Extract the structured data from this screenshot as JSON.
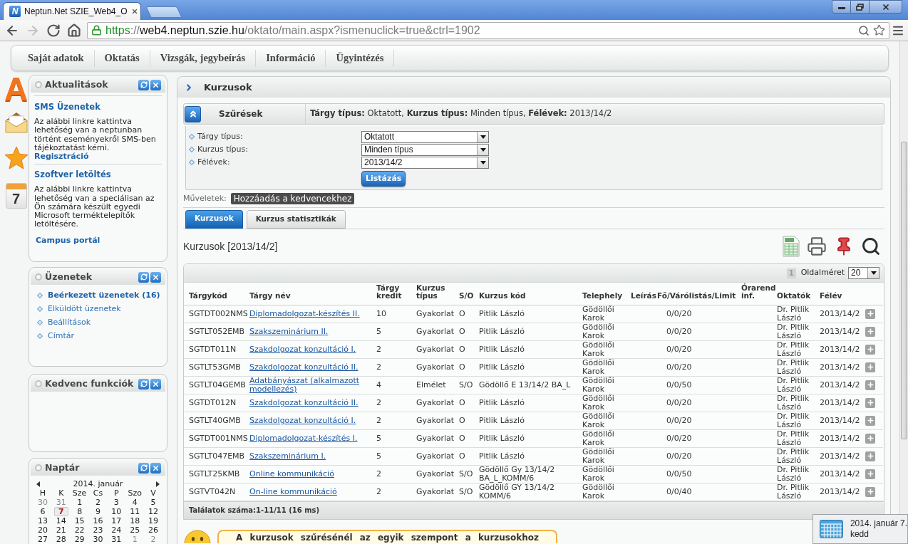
{
  "browser": {
    "tab": {
      "favicon_glyph": "N",
      "title": "Neptun.Net SZIE_Web4_O"
    },
    "nav": [
      {
        "kind": "back",
        "disabled": false
      },
      {
        "kind": "forward",
        "disabled": true
      },
      {
        "kind": "reload",
        "disabled": false
      },
      {
        "kind": "home",
        "disabled": false
      }
    ],
    "url": [
      {
        "kind": "scheme",
        "text": "https"
      },
      {
        "kind": "separator",
        "text": "://"
      },
      {
        "kind": "host",
        "text": "web4.neptun.szie.hu"
      },
      {
        "kind": "path",
        "text": "/oktato/main.aspx?ismenuclick=true&ctrl=1902"
      }
    ]
  },
  "main_menu": [
    "Saját adatok",
    "Oktatás",
    "Vizsgák, jegybeírás",
    "Információ",
    "Ügyintézés"
  ],
  "side_nav": [
    {
      "kind": "letter",
      "glyph": "A"
    },
    {
      "kind": "envelope"
    },
    {
      "kind": "star"
    },
    {
      "kind": "calendar",
      "glyph": "7"
    }
  ],
  "sidebar": [
    {
      "kind": "news",
      "title": "Aktualitások",
      "items": [
        {
          "heading": "SMS Üzenetek",
          "text": "Az alábbi linkre kattintva lehetőség van a neptunban történt eseményekről SMS-ben tájékoztatást kérni.",
          "link": "Regisztráció"
        },
        {
          "heading": "Szoftver letöltés",
          "text": "Az alábbi linkre kattintva lehetőség van a speciálisan az Ön számára készült egyedi Microsoft terméktelepítők letöltésére.",
          "link": "Campus portál"
        }
      ]
    },
    {
      "kind": "links",
      "title": "Üzenetek",
      "items": [
        {
          "label": "Beérkezett üzenetek (16)",
          "unread": true
        },
        {
          "label": "Elküldött üzenetek",
          "unread": false
        },
        {
          "label": "Beállítások",
          "unread": false
        },
        {
          "label": "Címtár",
          "unread": false
        }
      ]
    },
    {
      "kind": "empty",
      "title": "Kedvenc funkciók"
    },
    {
      "kind": "calendar",
      "title": "Naptár",
      "month": "2014. január",
      "weekdays": [
        "H",
        "K",
        "Sze",
        "Cs",
        "P",
        "Szo",
        "V"
      ],
      "weeks": [
        [
          {
            "day": "30",
            "outside": true,
            "today": false
          },
          {
            "day": "31",
            "outside": true,
            "today": false
          },
          {
            "day": "1",
            "outside": false,
            "today": false
          },
          {
            "day": "2",
            "outside": false,
            "today": false
          },
          {
            "day": "3",
            "outside": false,
            "today": false
          },
          {
            "day": "4",
            "outside": false,
            "today": false
          },
          {
            "day": "5",
            "outside": false,
            "today": false
          }
        ],
        [
          {
            "day": "6",
            "outside": false,
            "today": false
          },
          {
            "day": "7",
            "outside": false,
            "today": true
          },
          {
            "day": "8",
            "outside": false,
            "today": false
          },
          {
            "day": "9",
            "outside": false,
            "today": false
          },
          {
            "day": "10",
            "outside": false,
            "today": false
          },
          {
            "day": "11",
            "outside": false,
            "today": false
          },
          {
            "day": "12",
            "outside": false,
            "today": false
          }
        ],
        [
          {
            "day": "13",
            "outside": false,
            "today": false
          },
          {
            "day": "14",
            "outside": false,
            "today": false
          },
          {
            "day": "15",
            "outside": false,
            "today": false
          },
          {
            "day": "16",
            "outside": false,
            "today": false
          },
          {
            "day": "17",
            "outside": false,
            "today": false
          },
          {
            "day": "18",
            "outside": false,
            "today": false
          },
          {
            "day": "19",
            "outside": false,
            "today": false
          }
        ],
        [
          {
            "day": "20",
            "outside": false,
            "today": false
          },
          {
            "day": "21",
            "outside": false,
            "today": false
          },
          {
            "day": "22",
            "outside": false,
            "today": false
          },
          {
            "day": "23",
            "outside": false,
            "today": false
          },
          {
            "day": "24",
            "outside": false,
            "today": false
          },
          {
            "day": "25",
            "outside": false,
            "today": false
          },
          {
            "day": "26",
            "outside": false,
            "today": false
          }
        ],
        [
          {
            "day": "27",
            "outside": false,
            "today": false
          },
          {
            "day": "28",
            "outside": false,
            "today": false
          },
          {
            "day": "29",
            "outside": false,
            "today": false
          },
          {
            "day": "30",
            "outside": false,
            "today": false
          },
          {
            "day": "31",
            "outside": false,
            "today": false
          },
          {
            "day": "1",
            "outside": true,
            "today": false
          },
          {
            "day": "2",
            "outside": true,
            "today": false
          }
        ]
      ]
    }
  ],
  "content": {
    "title": "Kurzusok",
    "filter": {
      "title": "Szűrések",
      "expanded": true,
      "summary": "**Tárgy típus:** Oktatott, **Kurzus típus:** Minden típus, **Félévek:** 2013/14/2",
      "fields": [
        {
          "label": "Tárgy típus:",
          "value": "Oktatott"
        },
        {
          "label": "Kurzus típus:",
          "value": "Minden típus"
        },
        {
          "label": "Félévek:",
          "value": "2013/14/2"
        }
      ],
      "submit": "Listázás"
    },
    "actions": {
      "label": "Műveletek:",
      "buttons": [
        "Hozzáadás a kedvencekhez"
      ]
    },
    "tabs": [
      {
        "label": "Kurzusok",
        "selected": true
      },
      {
        "label": "Kurzus statisztikák",
        "selected": false
      }
    ],
    "list_title": "Kurzusok [2013/14/2]",
    "table": {
      "pages": [
        {
          "label": "1",
          "selected": true
        }
      ],
      "page_size_label": "Oldalméret",
      "page_size": "20",
      "columns": [
        "Tárgykód",
        "Tárgy név",
        "Tárgy kredit",
        "Kurzus típus",
        "S/O",
        "Kurzus kód",
        "Telephely",
        "Leírás",
        "Fő/Várólistás/Limit",
        "Órarend inf.",
        "Oktatók",
        "Félév"
      ],
      "rows": [
        {
          "code": "SGTDT002NMS",
          "name": "Diplomadolgozat-készítés II.",
          "credit": "10",
          "type": "Gyakorlat",
          "so": "O",
          "course_code": "Pitlik László",
          "site": "Gödöllői Karok",
          "places": "0/0/20",
          "teachers": "Dr. Pitlik László",
          "term": "2013/14/2"
        },
        {
          "code": "SGTLT052EMB",
          "name": "Szakszeminárium II.",
          "credit": "5",
          "type": "Gyakorlat",
          "so": "O",
          "course_code": "Pitlik László",
          "site": "Gödöllői Karok",
          "places": "0/0/20",
          "teachers": "Dr. Pitlik László",
          "term": "2013/14/2"
        },
        {
          "code": "SGTDT011N",
          "name": "Szakdolgozat konzultáció I.",
          "credit": "2",
          "type": "Gyakorlat",
          "so": "O",
          "course_code": "Pitlik László",
          "site": "Gödöllői Karok",
          "places": "0/0/20",
          "teachers": "Dr. Pitlik László",
          "term": "2013/14/2"
        },
        {
          "code": "SGTLT53GMB",
          "name": "Szakdolgozat konzultáció II.",
          "credit": "2",
          "type": "Gyakorlat",
          "so": "O",
          "course_code": "Pitlik László",
          "site": "Gödöllői Karok",
          "places": "0/0/20",
          "teachers": "Dr. Pitlik László",
          "term": "2013/14/2"
        },
        {
          "code": "SGTLT04GEMB",
          "name": "Adatbányászat (alkalmazott modellezés)",
          "credit": "4",
          "type": "Elmélet",
          "so": "S/O",
          "course_code": "Gödöllő E 13/14/2 BA_L",
          "site": "Gödöllői Karok",
          "places": "0/0/50",
          "teachers": "Dr. Pitlik László",
          "term": "2013/14/2"
        },
        {
          "code": "SGTDT012N",
          "name": "Szakdolgozat konzultáció II.",
          "credit": "2",
          "type": "Gyakorlat",
          "so": "O",
          "course_code": "Pitlik László",
          "site": "Gödöllői Karok",
          "places": "0/0/20",
          "teachers": "Dr. Pitlik László",
          "term": "2013/14/2"
        },
        {
          "code": "SGTLT40GMB",
          "name": "Szakdolgozat konzultáció I.",
          "credit": "2",
          "type": "Gyakorlat",
          "so": "O",
          "course_code": "Pitlik László",
          "site": "Gödöllői Karok",
          "places": "0/0/20",
          "teachers": "Dr. Pitlik László",
          "term": "2013/14/2"
        },
        {
          "code": "SGTDT001NMS",
          "name": "Diplomadolgozat-készítés I.",
          "credit": "5",
          "type": "Gyakorlat",
          "so": "O",
          "course_code": "Pitlik László",
          "site": "Gödöllői Karok",
          "places": "0/0/20",
          "teachers": "Dr. Pitlik László",
          "term": "2013/14/2"
        },
        {
          "code": "SGTLT047EMB",
          "name": "Szakszeminárium I.",
          "credit": "5",
          "type": "Gyakorlat",
          "so": "O",
          "course_code": "Pitlik László",
          "site": "Gödöllői Karok",
          "places": "0/0/20",
          "teachers": "Dr. Pitlik László",
          "term": "2013/14/2"
        },
        {
          "code": "SGTLT25KMB",
          "name": "Online kommunikáció",
          "credit": "2",
          "type": "Gyakorlat",
          "so": "S/O",
          "course_code": "Gödöllő Gy 13/14/2 BA_L_KOMM/6",
          "site": "Gödöllői Karok",
          "places": "0/0/50",
          "teachers": "Dr. Pitlik László",
          "term": "2013/14/2"
        },
        {
          "code": "SGTVT042N",
          "name": "On-line kommunikáció",
          "credit": "2",
          "type": "Gyakorlat",
          "so": "S/O",
          "course_code": "Gödöllő GY 13/14/2 KOMM/6",
          "site": "Gödöllői Karok",
          "places": "0/0/40",
          "teachers": "Dr. Pitlik László",
          "term": "2013/14/2"
        }
      ],
      "footer": "Találatok száma:1-11/11 (16 ms)"
    },
    "hint": "A kurzusok szűrésénél az egyik szempont a kurzusokhoz"
  },
  "notification": {
    "date": "2014. január 7.",
    "weekday": "kedd"
  }
}
